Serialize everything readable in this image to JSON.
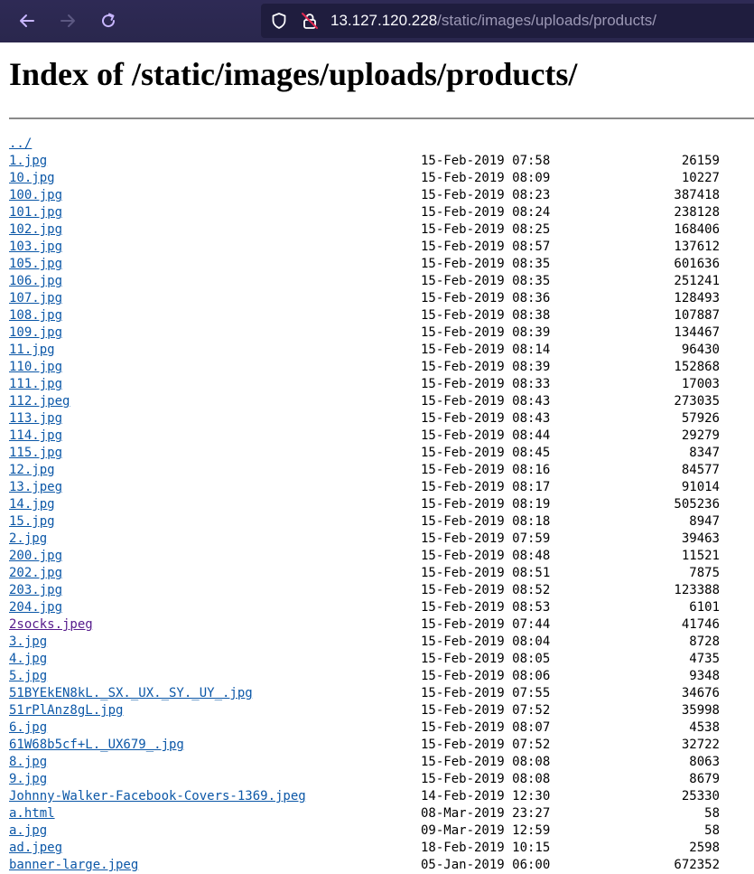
{
  "browser": {
    "url_host": "13.127.120.228",
    "url_path": "/static/images/uploads/products/",
    "icons": [
      "back-arrow-icon",
      "forward-arrow-icon",
      "reload-icon",
      "shield-icon",
      "insecure-lock-icon"
    ]
  },
  "page": {
    "title": "Index of /static/images/uploads/products/",
    "parent_link": "../"
  },
  "files": [
    {
      "name": "1.jpg",
      "date": "15-Feb-2019 07:58",
      "size": "26159"
    },
    {
      "name": "10.jpg",
      "date": "15-Feb-2019 08:09",
      "size": "10227"
    },
    {
      "name": "100.jpg",
      "date": "15-Feb-2019 08:23",
      "size": "387418"
    },
    {
      "name": "101.jpg",
      "date": "15-Feb-2019 08:24",
      "size": "238128"
    },
    {
      "name": "102.jpg",
      "date": "15-Feb-2019 08:25",
      "size": "168406"
    },
    {
      "name": "103.jpg",
      "date": "15-Feb-2019 08:57",
      "size": "137612"
    },
    {
      "name": "105.jpg",
      "date": "15-Feb-2019 08:35",
      "size": "601636"
    },
    {
      "name": "106.jpg",
      "date": "15-Feb-2019 08:35",
      "size": "251241"
    },
    {
      "name": "107.jpg",
      "date": "15-Feb-2019 08:36",
      "size": "128493"
    },
    {
      "name": "108.jpg",
      "date": "15-Feb-2019 08:38",
      "size": "107887"
    },
    {
      "name": "109.jpg",
      "date": "15-Feb-2019 08:39",
      "size": "134467"
    },
    {
      "name": "11.jpg",
      "date": "15-Feb-2019 08:14",
      "size": "96430"
    },
    {
      "name": "110.jpg",
      "date": "15-Feb-2019 08:39",
      "size": "152868"
    },
    {
      "name": "111.jpg",
      "date": "15-Feb-2019 08:33",
      "size": "17003"
    },
    {
      "name": "112.jpeg",
      "date": "15-Feb-2019 08:43",
      "size": "273035"
    },
    {
      "name": "113.jpg",
      "date": "15-Feb-2019 08:43",
      "size": "57926"
    },
    {
      "name": "114.jpg",
      "date": "15-Feb-2019 08:44",
      "size": "29279"
    },
    {
      "name": "115.jpg",
      "date": "15-Feb-2019 08:45",
      "size": "8347"
    },
    {
      "name": "12.jpg",
      "date": "15-Feb-2019 08:16",
      "size": "84577"
    },
    {
      "name": "13.jpeg",
      "date": "15-Feb-2019 08:17",
      "size": "91014"
    },
    {
      "name": "14.jpg",
      "date": "15-Feb-2019 08:19",
      "size": "505236"
    },
    {
      "name": "15.jpg",
      "date": "15-Feb-2019 08:18",
      "size": "8947"
    },
    {
      "name": "2.jpg",
      "date": "15-Feb-2019 07:59",
      "size": "39463"
    },
    {
      "name": "200.jpg",
      "date": "15-Feb-2019 08:48",
      "size": "11521"
    },
    {
      "name": "202.jpg",
      "date": "15-Feb-2019 08:51",
      "size": "7875"
    },
    {
      "name": "203.jpg",
      "date": "15-Feb-2019 08:52",
      "size": "123388"
    },
    {
      "name": "204.jpg",
      "date": "15-Feb-2019 08:53",
      "size": "6101"
    },
    {
      "name": "2socks.jpeg",
      "date": "15-Feb-2019 07:44",
      "size": "41746",
      "visited": true
    },
    {
      "name": "3.jpg",
      "date": "15-Feb-2019 08:04",
      "size": "8728"
    },
    {
      "name": "4.jpg",
      "date": "15-Feb-2019 08:05",
      "size": "4735"
    },
    {
      "name": "5.jpg",
      "date": "15-Feb-2019 08:06",
      "size": "9348"
    },
    {
      "name": "51BYEkEN8kL._SX._UX._SY._UY_.jpg",
      "date": "15-Feb-2019 07:55",
      "size": "34676"
    },
    {
      "name": "51rPlAnz8gL.jpg",
      "date": "15-Feb-2019 07:52",
      "size": "35998"
    },
    {
      "name": "6.jpg",
      "date": "15-Feb-2019 08:07",
      "size": "4538"
    },
    {
      "name": "61W68b5cf+L._UX679_.jpg",
      "date": "15-Feb-2019 07:52",
      "size": "32722"
    },
    {
      "name": "8.jpg",
      "date": "15-Feb-2019 08:08",
      "size": "8063"
    },
    {
      "name": "9.jpg",
      "date": "15-Feb-2019 08:08",
      "size": "8679"
    },
    {
      "name": "Johnny-Walker-Facebook-Covers-1369.jpeg",
      "date": "14-Feb-2019 12:30",
      "size": "25330"
    },
    {
      "name": "a.html",
      "date": "08-Mar-2019 23:27",
      "size": "58"
    },
    {
      "name": "a.jpg",
      "date": "09-Mar-2019 12:59",
      "size": "58"
    },
    {
      "name": "ad.jpeg",
      "date": "18-Feb-2019 10:15",
      "size": "2598"
    },
    {
      "name": "banner-large.jpeg",
      "date": "05-Jan-2019 06:00",
      "size": "672352"
    }
  ],
  "colors": {
    "link": "#0b57a7",
    "visited_link": "#551a8b",
    "toolbar": "#2b2a4c",
    "urlbar": "#1f1d3e"
  }
}
